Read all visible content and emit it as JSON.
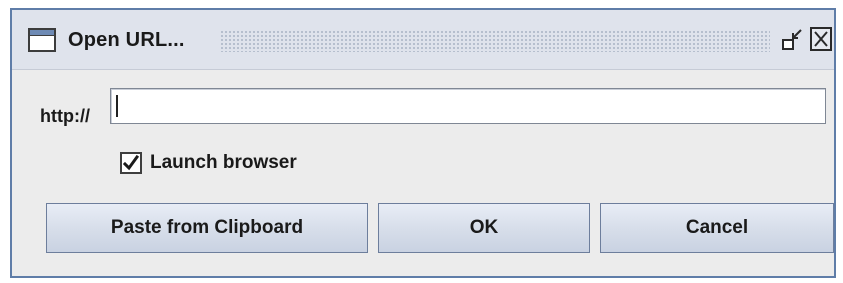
{
  "window": {
    "title": "Open URL..."
  },
  "icons": {
    "window": "window-icon",
    "restore": "restore-icon",
    "close": "close-icon",
    "check": "checkmark-icon"
  },
  "form": {
    "url_label": "http://",
    "url_value": "",
    "launch_browser_label": "Launch browser",
    "launch_browser_checked": true
  },
  "buttons": {
    "paste_label": "Paste from Clipboard",
    "ok_label": "OK",
    "cancel_label": "Cancel"
  },
  "colors": {
    "window_border": "#5f7da8",
    "titlebar_bg": "#dfe3ec",
    "dialog_bg": "#ececec",
    "button_bg": "#d6dde9"
  }
}
